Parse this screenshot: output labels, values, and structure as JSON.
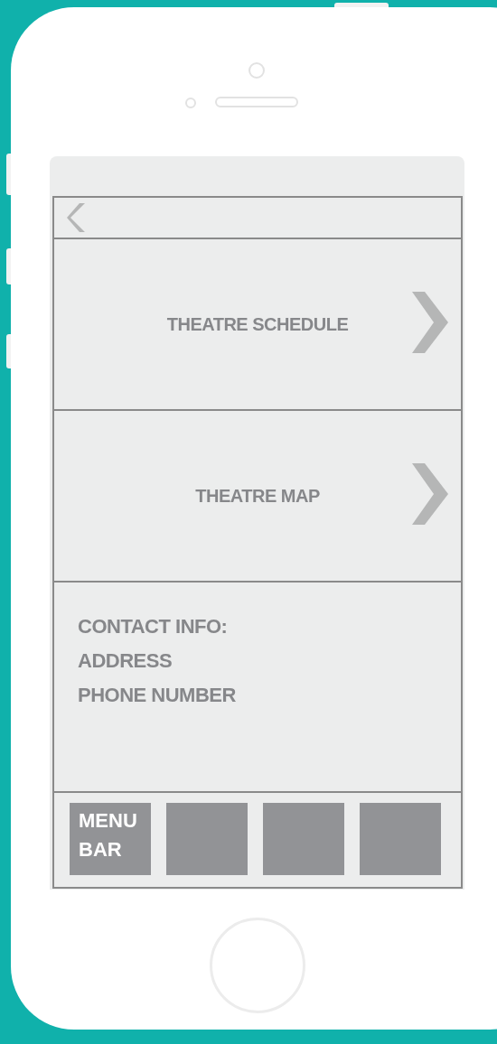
{
  "nav_items": [
    {
      "label": "THEATRE SCHEDULE"
    },
    {
      "label": "THEATRE MAP"
    }
  ],
  "contact": [
    "CONTACT INFO:",
    "ADDRESS",
    "PHONE NUMBER"
  ],
  "menu_bar": [
    {
      "kind": "label",
      "label": "MENU BAR"
    },
    {
      "kind": "blank"
    },
    {
      "kind": "blank"
    },
    {
      "kind": "blank"
    }
  ]
}
